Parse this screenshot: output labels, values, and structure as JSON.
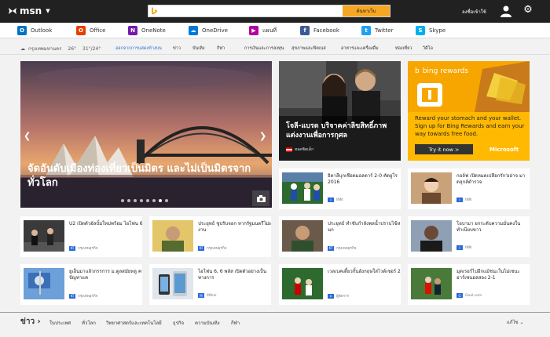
{
  "header": {
    "logo": "msn",
    "search_placeholder": "",
    "search_button": "ค้นหาเว็บ",
    "signin": "ลงชื่อเข้าใช้"
  },
  "apps": [
    {
      "label": "Outlook",
      "icon": "outlook-icon",
      "color": "#0072c6",
      "letter": "O"
    },
    {
      "label": "Office",
      "icon": "office-icon",
      "color": "#eb3c00",
      "letter": "O"
    },
    {
      "label": "OneNote",
      "icon": "onenote-icon",
      "color": "#7719aa",
      "letter": "N"
    },
    {
      "label": "OneDrive",
      "icon": "onedrive-icon",
      "color": "#0078d7",
      "letter": "☁"
    },
    {
      "label": "แผนที่",
      "icon": "maps-icon",
      "color": "#b4009e",
      "letter": "▶"
    },
    {
      "label": "Facebook",
      "icon": "facebook-icon",
      "color": "#3b5998",
      "letter": "f"
    },
    {
      "label": "Twitter",
      "icon": "twitter-icon",
      "color": "#1da1f2",
      "letter": "t"
    },
    {
      "label": "Skype",
      "icon": "skype-icon",
      "color": "#00aff0",
      "letter": "S"
    }
  ],
  "weather": {
    "city": "กรุงเทพมหานคร",
    "temp": "26°",
    "range": "31°/24°"
  },
  "nav": [
    "ออกจากการแสดงข้างบน",
    "ข่าว",
    "บันเทิง",
    "กีฬา",
    "การเงินและการลงทุน",
    "สุขภาพและฟิตเนส",
    "อาหารและเครื่องดื่ม",
    "ท่องเที่ยว",
    "วิดีโอ"
  ],
  "hero": {
    "caption": "จัดอันดับเมืองท่องเที่ยวเป็นมิตร และไม่เป็นมิตรจากทั่วโลก",
    "dots": 8,
    "active_dot": 6
  },
  "feature": {
    "caption": "โจลี-แบรด บริจาคค่าลิขสิทธิ์ภาพแต่งงานเพื่อการกุศล",
    "source": "ทอดซิตเด็ก"
  },
  "ad": {
    "brand": "bing rewards",
    "text": "Reward your stomach and your wallet. Sign up for Bing Rewards and earn your way towards free food.",
    "button": "Try it now >",
    "sponsor": "Microsoft"
  },
  "cards": [
    {
      "title": "อิตาลีบุกเชือดมอลตาร์ 2-0 คัดยูโร 2016",
      "source": "INN",
      "src_letter": "I"
    },
    {
      "title": "กอล์ฟ เปิดหมดเปลือกรัก'ออ่าจ มาดลุกส์ตำรวจ",
      "source": "INN",
      "src_letter": "I"
    },
    {
      "title": "U2 เปิดตัวอัลบั้มใหม่พร้อม ไอโฟน 6",
      "source": "กรุงเทพธุรกิจ",
      "src_letter": "KT"
    },
    {
      "title": "ประยุทธ์ ชูปรับจอก หากรัฐมนตรีไม่ผลงาน",
      "source": "กรุงเทพธุรกิจ",
      "src_letter": "KT"
    },
    {
      "title": "ประยุทธ์ ทำชับกำลังพลน้ำปราบไข้หวัดนก",
      "source": "กรุงเทพธุรกิจ",
      "src_letter": "KT"
    },
    {
      "title": "โอบามา ยกระดับความมั่นคงในทำเนียบขาว",
      "source": "INN",
      "src_letter": "I"
    },
    {
      "title": "ยูเอ็นมาแล้วกรรการ ม.ตูลสมัยหลู คาปัญหาแค",
      "source": "กรุงเทพธุรกิจ",
      "src_letter": "KT"
    },
    {
      "title": "ไอโฟน 6, 6 พลัส เปิดตัวอย่างเป็นทางการ",
      "source": "Mthai",
      "src_letter": "M"
    },
    {
      "title": "เวลเบคเดี้ยวกั้นอังกฤษใสไวต์เซอร์ 2-0",
      "source": "ผู้จัดการ",
      "src_letter": "ผ"
    },
    {
      "title": "มุตเรอร์ไปอีกแม้ชนะในไม่เชนะอาร์เซนอลสอง 2-1",
      "source": "Goal.com",
      "src_letter": "G"
    }
  ],
  "footer": {
    "head": "ข่าว",
    "links": [
      "ในประเทศ",
      "ทั่วโลก",
      "วิทยาศาสตร์และเทคโนโลยี",
      "ธุรกิจ",
      "ความบันเทิง",
      "กีฬา"
    ],
    "more": "แก้ไข"
  }
}
